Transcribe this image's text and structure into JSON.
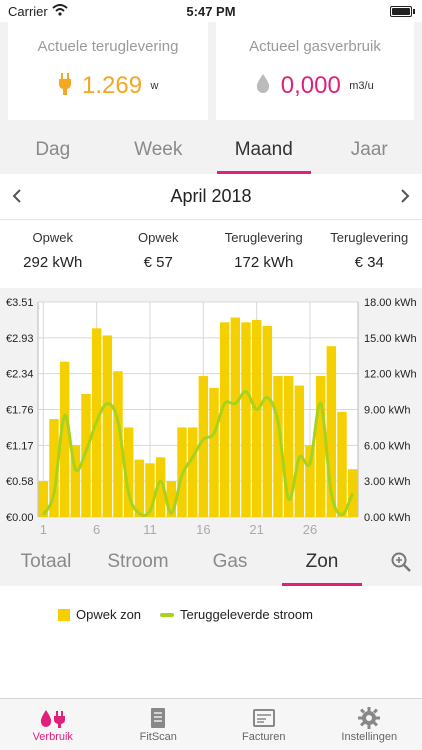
{
  "status": {
    "carrier": "Carrier",
    "time": "5:47 PM"
  },
  "cards": [
    {
      "label": "Actuele teruglevering",
      "value": "1.269",
      "unit": "w",
      "icon": "plug-icon",
      "color": "#f5a623"
    },
    {
      "label": "Actueel gasverbruik",
      "value": "0,000",
      "unit": "m3/u",
      "icon": "drop-icon",
      "color": "#e0217a"
    }
  ],
  "period_tabs": [
    {
      "label": "Dag",
      "active": false
    },
    {
      "label": "Week",
      "active": false
    },
    {
      "label": "Maand",
      "active": true
    },
    {
      "label": "Jaar",
      "active": false
    }
  ],
  "month": {
    "label": "April 2018"
  },
  "stats": [
    {
      "label": "Opwek",
      "value": "292 kWh"
    },
    {
      "label": "Opwek",
      "value": "€ 57"
    },
    {
      "label": "Teruglevering",
      "value": "172 kWh"
    },
    {
      "label": "Teruglevering",
      "value": "€ 34"
    }
  ],
  "type_tabs": [
    {
      "label": "Totaal",
      "active": false
    },
    {
      "label": "Stroom",
      "active": false
    },
    {
      "label": "Gas",
      "active": false
    },
    {
      "label": "Zon",
      "active": true
    }
  ],
  "legend": [
    {
      "label": "Opwek zon",
      "color": "#f5d000"
    },
    {
      "label": "Teruggeleverde stroom",
      "color": "#a8d21e"
    }
  ],
  "bottom_tabs": [
    {
      "label": "Verbruik",
      "icon": "drop-plug-icon",
      "active": true
    },
    {
      "label": "FitScan",
      "icon": "document-icon",
      "active": false
    },
    {
      "label": "Facturen",
      "icon": "invoice-icon",
      "active": false
    },
    {
      "label": "Instellingen",
      "icon": "gear-icon",
      "active": false
    }
  ],
  "chart_data": {
    "type": "bar",
    "categories": [
      "1",
      "2",
      "3",
      "4",
      "5",
      "6",
      "7",
      "8",
      "9",
      "10",
      "11",
      "12",
      "13",
      "14",
      "15",
      "16",
      "17",
      "18",
      "19",
      "20",
      "21",
      "22",
      "23",
      "24",
      "25",
      "26",
      "27",
      "28",
      "29",
      "30"
    ],
    "x_tick_labels": [
      "1",
      "6",
      "11",
      "16",
      "21",
      "26"
    ],
    "series": [
      {
        "name": "Opwek zon",
        "axis": "right",
        "kind": "bar",
        "color": "#f5d000",
        "values": [
          3.0,
          8.2,
          13.0,
          6.0,
          10.3,
          15.8,
          15.2,
          12.2,
          7.5,
          4.8,
          4.5,
          5.0,
          3.0,
          7.5,
          7.5,
          11.8,
          10.8,
          16.3,
          16.7,
          16.3,
          16.5,
          16.0,
          11.8,
          11.8,
          11.0,
          6.0,
          11.8,
          14.3,
          8.8,
          4.0
        ]
      },
      {
        "name": "Teruggeleverde stroom",
        "axis": "right",
        "kind": "line",
        "color": "#a8d21e",
        "values": [
          0.2,
          2.0,
          8.5,
          4.0,
          5.5,
          8.0,
          9.5,
          8.0,
          2.0,
          0.3,
          0.5,
          3.0,
          0.3,
          3.5,
          5.0,
          6.5,
          7.0,
          9.5,
          9.5,
          10.5,
          9.0,
          10.0,
          8.0,
          1.5,
          5.0,
          4.5,
          9.5,
          2.0,
          0.2,
          2.0
        ]
      }
    ],
    "y_left_ticks": [
      "€0.00",
      "€0.58",
      "€1.17",
      "€1.76",
      "€2.34",
      "€2.93",
      "€3.51"
    ],
    "y_right_ticks": [
      "0.00 kWh",
      "3.00 kWh",
      "6.00 kWh",
      "9.00 kWh",
      "12.00 kWh",
      "15.00 kWh",
      "18.00 kWh"
    ],
    "ylim": [
      0,
      18
    ],
    "grid": true
  }
}
